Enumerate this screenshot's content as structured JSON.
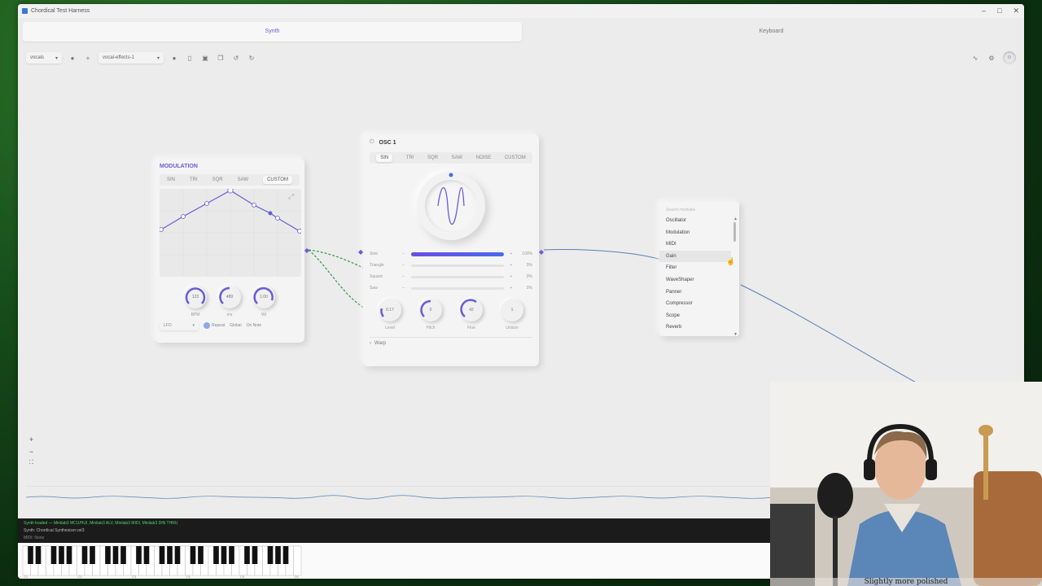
{
  "window": {
    "title": "Chordical Test Harness",
    "controls": [
      "–",
      "□",
      "✕"
    ]
  },
  "tabs": [
    {
      "label": "Synth",
      "active": true
    },
    {
      "label": "Keyboard",
      "active": false
    }
  ],
  "toolbar": {
    "preset_select": "vocals",
    "chain_select": "vocal-effects-1"
  },
  "modulation": {
    "title": "MODULATION",
    "waves": [
      "SIN",
      "TRI",
      "SQR",
      "SAW",
      "CUSTOM"
    ],
    "active_wave": "CUSTOM",
    "knobs": [
      {
        "value": "123",
        "label": "BPM"
      },
      {
        "value": "489",
        "label": "ms"
      },
      {
        "value": "1.00",
        "label": "Wt"
      }
    ],
    "mode": "LFO",
    "options": [
      "Repeat",
      "Global",
      "On Note"
    ]
  },
  "osc": {
    "title": "OSC 1",
    "waves": [
      "SIN",
      "TRI",
      "SQR",
      "SAW",
      "NOISE",
      "CUSTOM"
    ],
    "active_wave": "SIN",
    "mix": [
      {
        "name": "Sine",
        "pct": "100%",
        "level": 1.0
      },
      {
        "name": "Triangle",
        "pct": "0%",
        "level": 0
      },
      {
        "name": "Square",
        "pct": "0%",
        "level": 0
      },
      {
        "name": "Saw",
        "pct": "0%",
        "level": 0
      }
    ],
    "knobs": [
      {
        "value": "0.17",
        "label": "Level"
      },
      {
        "value": "0",
        "label": "Pitch"
      },
      {
        "value": "42",
        "label": "Fine"
      },
      {
        "value": "1",
        "label": "Unison"
      }
    ],
    "warp_label": "Warp"
  },
  "module_menu": {
    "search_placeholder": "Search modules",
    "items": [
      "Oscillator",
      "Modulation",
      "MIDI",
      "Gain",
      "Filter",
      "WaveShaper",
      "Panner",
      "Compressor",
      "Scope",
      "Reverb"
    ],
    "highlighted": "Gain"
  },
  "zoom": {
    "in": "+",
    "out": "−",
    "fit": "⛶"
  },
  "status": {
    "line1": "Synth loaded — Minilab3 MCU/HUI, Minilab3 ALV, Minilab3 MIDI, Minilab3 DIN THRU",
    "line2": "Synth: Chordical Synthesizer.vst3",
    "line3": "MIDI: None"
  },
  "octave_labels": [
    "C1",
    "C2",
    "C3",
    "C4",
    "C5",
    "C6"
  ],
  "caption": "Slightly more polished",
  "colors": {
    "accent": "#6a5cd6",
    "cable_green": "#2e9a4a",
    "cable_blue": "#5b7fb0"
  }
}
